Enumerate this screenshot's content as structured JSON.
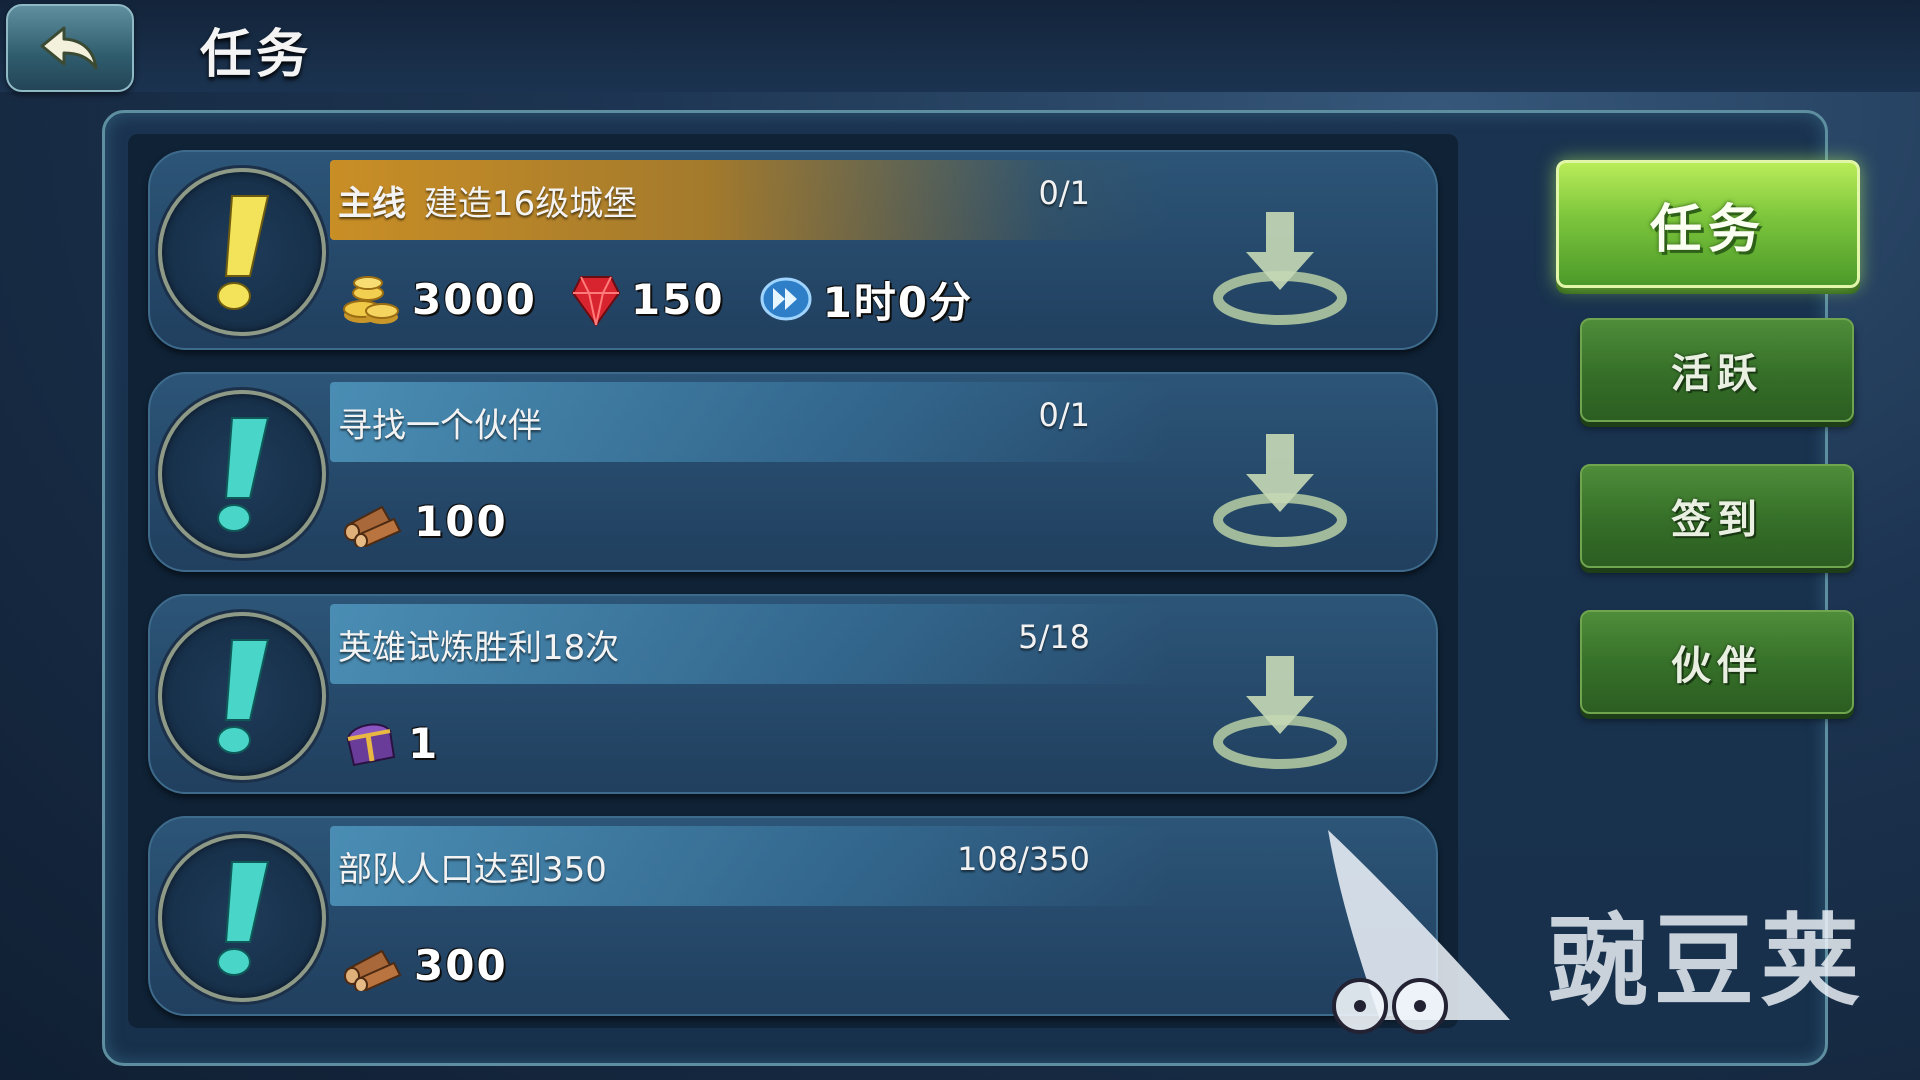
{
  "header": {
    "title": "任务"
  },
  "tasks": [
    {
      "tag": "主线",
      "name": "建造16级城堡",
      "progress": "0/1",
      "rewards": [
        {
          "icon": "gold-coins-icon",
          "value": "3000"
        },
        {
          "icon": "red-gem-icon",
          "value": "150"
        },
        {
          "icon": "speedup-icon",
          "value": "1时0分"
        }
      ]
    },
    {
      "tag": "",
      "name": "寻找一个伙伴",
      "progress": "0/1",
      "rewards": [
        {
          "icon": "wood-logs-icon",
          "value": "100"
        }
      ]
    },
    {
      "tag": "",
      "name": "英雄试炼胜利18次",
      "progress": "5/18",
      "rewards": [
        {
          "icon": "treasure-chest-icon",
          "value": "1"
        }
      ]
    },
    {
      "tag": "",
      "name": "部队人口达到350",
      "progress": "108/350",
      "rewards": [
        {
          "icon": "wood-logs-icon",
          "value": "300"
        }
      ]
    }
  ],
  "tabs": [
    {
      "label": "任务",
      "active": true
    },
    {
      "label": "活跃",
      "active": false
    },
    {
      "label": "签到",
      "active": false
    },
    {
      "label": "伙伴",
      "active": false
    }
  ],
  "watermark": {
    "text": "豌豆荚"
  },
  "colors": {
    "main_task_strip": "#c98e26",
    "side_task_strip": "#54a0c8",
    "tab_green": "#356f28",
    "tab_active_green": "#7cc53c",
    "exclamation_main": "#f3e35a",
    "exclamation_side": "#49d6c8"
  }
}
